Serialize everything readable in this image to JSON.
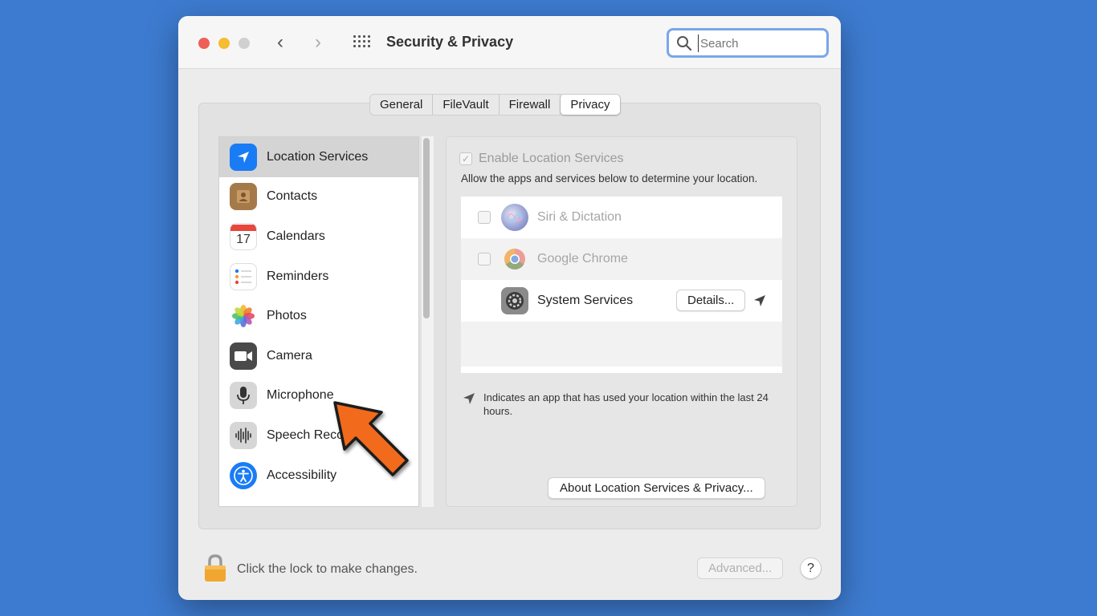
{
  "window": {
    "title": "Security & Privacy",
    "search_placeholder": "Search"
  },
  "tabs": [
    {
      "label": "General",
      "active": false
    },
    {
      "label": "FileVault",
      "active": false
    },
    {
      "label": "Firewall",
      "active": false
    },
    {
      "label": "Privacy",
      "active": true
    }
  ],
  "sidebar": {
    "items": [
      {
        "label": "Location Services",
        "icon": "location-arrow-icon",
        "selected": true
      },
      {
        "label": "Contacts",
        "icon": "contacts-book-icon",
        "selected": false
      },
      {
        "label": "Calendars",
        "icon": "calendar-icon",
        "calendar_day": "17",
        "selected": false
      },
      {
        "label": "Reminders",
        "icon": "reminders-list-icon",
        "selected": false
      },
      {
        "label": "Photos",
        "icon": "photos-flower-icon",
        "selected": false
      },
      {
        "label": "Camera",
        "icon": "camera-icon",
        "selected": false
      },
      {
        "label": "Microphone",
        "icon": "microphone-icon",
        "selected": false
      },
      {
        "label": "Speech Recognition",
        "icon": "speech-waveform-icon",
        "selected": false
      },
      {
        "label": "Accessibility",
        "icon": "accessibility-icon",
        "selected": false
      }
    ]
  },
  "location": {
    "enable_label": "Enable Location Services",
    "enable_checked": true,
    "allow_text": "Allow the apps and services below to determine your location.",
    "apps": [
      {
        "name": "Siri & Dictation",
        "icon": "siri-icon",
        "checked": false,
        "dimmed": true
      },
      {
        "name": "Google Chrome",
        "icon": "chrome-icon",
        "checked": false,
        "dimmed": true
      },
      {
        "name": "System Services",
        "icon": "gear-icon",
        "dimmed": false,
        "details_label": "Details..."
      }
    ],
    "indicates_text": "Indicates an app that has used your location within the last 24 hours.",
    "about_label": "About Location Services & Privacy..."
  },
  "footer": {
    "lock_text": "Click the lock to make changes.",
    "advanced_label": "Advanced...",
    "help_label": "?"
  },
  "colors": {
    "background": "#3d7bd0",
    "annotation_arrow": "#f26b1d",
    "accent_blue": "#1a7cf5"
  }
}
